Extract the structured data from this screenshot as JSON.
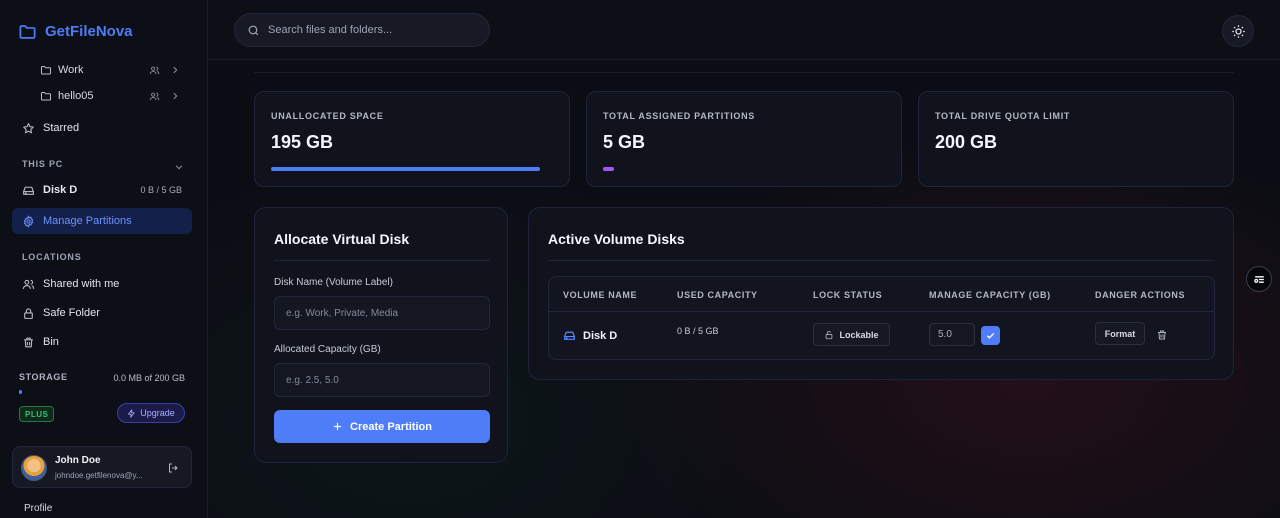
{
  "brand": {
    "name": "GetFileNova"
  },
  "sidebar": {
    "folders": [
      {
        "label": "Work"
      },
      {
        "label": "hello05"
      }
    ],
    "starred": "Starred",
    "this_pc_label": "THIS PC",
    "disk": {
      "label": "Disk D",
      "usage": "0 B / 5 GB"
    },
    "manage_partitions": "Manage Partitions",
    "locations_label": "LOCATIONS",
    "locations": [
      {
        "label": "Shared with me"
      },
      {
        "label": "Safe Folder"
      },
      {
        "label": "Bin"
      }
    ],
    "storage": {
      "label": "STORAGE",
      "value": "0.0 MB of 200 GB",
      "used_fraction": 0.0
    },
    "plan": "PLUS",
    "upgrade": "Upgrade",
    "user": {
      "name": "John Doe",
      "email": "johndoe.getfilenova@y..."
    },
    "profile_peek": "Profile"
  },
  "topbar": {
    "search_placeholder": "Search files and folders..."
  },
  "stats": [
    {
      "title": "UNALLOCATED SPACE",
      "value": "195 GB",
      "fill_fraction": 0.975,
      "color": "#4e7cf5"
    },
    {
      "title": "TOTAL ASSIGNED PARTITIONS",
      "value": "5 GB",
      "fill_fraction": 0.025,
      "color": "#a855f7"
    },
    {
      "title": "TOTAL DRIVE QUOTA LIMIT",
      "value": "200 GB",
      "fill_fraction": null,
      "color": ""
    }
  ],
  "allocate": {
    "title": "Allocate Virtual Disk",
    "name_label": "Disk Name (Volume Label)",
    "name_placeholder": "e.g. Work, Private, Media",
    "capacity_label": "Allocated Capacity (GB)",
    "capacity_placeholder": "e.g. 2.5, 5.0",
    "create_button": "Create Partition"
  },
  "volumes": {
    "title": "Active Volume Disks",
    "columns": [
      "VOLUME NAME",
      "USED CAPACITY",
      "LOCK STATUS",
      "MANAGE CAPACITY (GB)",
      "DANGER ACTIONS"
    ],
    "rows": [
      {
        "name": "Disk D",
        "used": "0 B / 5 GB",
        "lock": "Lockable",
        "capacity": "5.0",
        "format": "Format"
      }
    ]
  },
  "colors": {
    "accent": "#4f7cf7",
    "brand": "#4e7cf5",
    "plan_green": "#34c46f",
    "partition_purple": "#a855f7"
  }
}
